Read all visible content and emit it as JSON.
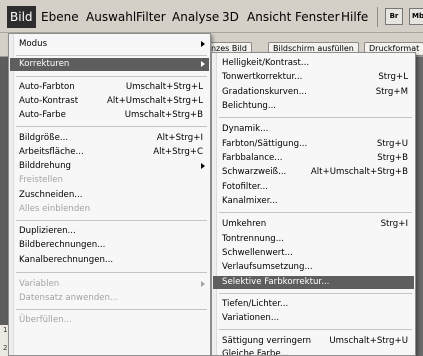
{
  "menubar": {
    "items": [
      "Bild",
      "Ebene",
      "Auswahl",
      "Filter",
      "Analyse",
      "3D",
      "Ansicht",
      "Fenster",
      "Hilfe"
    ],
    "icons": [
      "Br",
      "Mb"
    ]
  },
  "optionsbar": {
    "buttons": [
      "ganzes Bild",
      "Bildschirm ausfüllen",
      "Druckformat"
    ]
  },
  "ruler": {
    "ticks": [
      "1",
      "2"
    ]
  },
  "main_menu": {
    "items": [
      {
        "label": "Modus",
        "shortcut": "",
        "submenu": true,
        "disabled": false
      },
      {
        "label": "Korrekturen",
        "shortcut": "",
        "submenu": true,
        "disabled": false,
        "highlighted": true
      },
      {
        "label": "Auto-Farbton",
        "shortcut": "Umschalt+Strg+L",
        "disabled": false
      },
      {
        "label": "Auto-Kontrast",
        "shortcut": "Alt+Umschalt+Strg+L",
        "disabled": false
      },
      {
        "label": "Auto-Farbe",
        "shortcut": "Umschalt+Strg+B",
        "disabled": false
      },
      {
        "label": "Bildgröße...",
        "shortcut": "Alt+Strg+I",
        "disabled": false
      },
      {
        "label": "Arbeitsfläche...",
        "shortcut": "Alt+Strg+C",
        "disabled": false
      },
      {
        "label": "Bilddrehung",
        "shortcut": "",
        "submenu": true,
        "disabled": false
      },
      {
        "label": "Freistellen",
        "shortcut": "",
        "disabled": true
      },
      {
        "label": "Zuschneiden...",
        "shortcut": "",
        "disabled": false
      },
      {
        "label": "Alles einblenden",
        "shortcut": "",
        "disabled": true
      },
      {
        "label": "Duplizieren...",
        "shortcut": "",
        "disabled": false
      },
      {
        "label": "Bildberechnungen...",
        "shortcut": "",
        "disabled": false
      },
      {
        "label": "Kanalberechnungen...",
        "shortcut": "",
        "disabled": false
      },
      {
        "label": "Variablen",
        "shortcut": "",
        "submenu": true,
        "disabled": true
      },
      {
        "label": "Datensatz anwenden...",
        "shortcut": "",
        "disabled": true
      },
      {
        "label": "Überfüllen...",
        "shortcut": "",
        "disabled": true
      }
    ]
  },
  "sub_menu": {
    "items": [
      {
        "label": "Helligkeit/Kontrast...",
        "shortcut": ""
      },
      {
        "label": "Tonwertkorrektur...",
        "shortcut": "Strg+L"
      },
      {
        "label": "Gradationskurven...",
        "shortcut": "Strg+M"
      },
      {
        "label": "Belichtung...",
        "shortcut": ""
      },
      {
        "label": "Dynamik...",
        "shortcut": ""
      },
      {
        "label": "Farbton/Sättigung...",
        "shortcut": "Strg+U"
      },
      {
        "label": "Farbbalance...",
        "shortcut": "Strg+B"
      },
      {
        "label": "Schwarzweiß...",
        "shortcut": "Alt+Umschalt+Strg+B"
      },
      {
        "label": "Fotofilter...",
        "shortcut": ""
      },
      {
        "label": "Kanalmixer...",
        "shortcut": ""
      },
      {
        "label": "Umkehren",
        "shortcut": "Strg+I"
      },
      {
        "label": "Tontrennung...",
        "shortcut": ""
      },
      {
        "label": "Schwellenwert...",
        "shortcut": ""
      },
      {
        "label": "Verlaufsumsetzung...",
        "shortcut": ""
      },
      {
        "label": "Selektive Farbkorrektur...",
        "shortcut": "",
        "highlighted": true
      },
      {
        "label": "Tiefen/Lichter...",
        "shortcut": ""
      },
      {
        "label": "Variationen...",
        "shortcut": ""
      },
      {
        "label": "Sättigung verringern",
        "shortcut": "Umschalt+Strg+U"
      },
      {
        "label": "Gleiche Farbe...",
        "shortcut": ""
      }
    ]
  }
}
